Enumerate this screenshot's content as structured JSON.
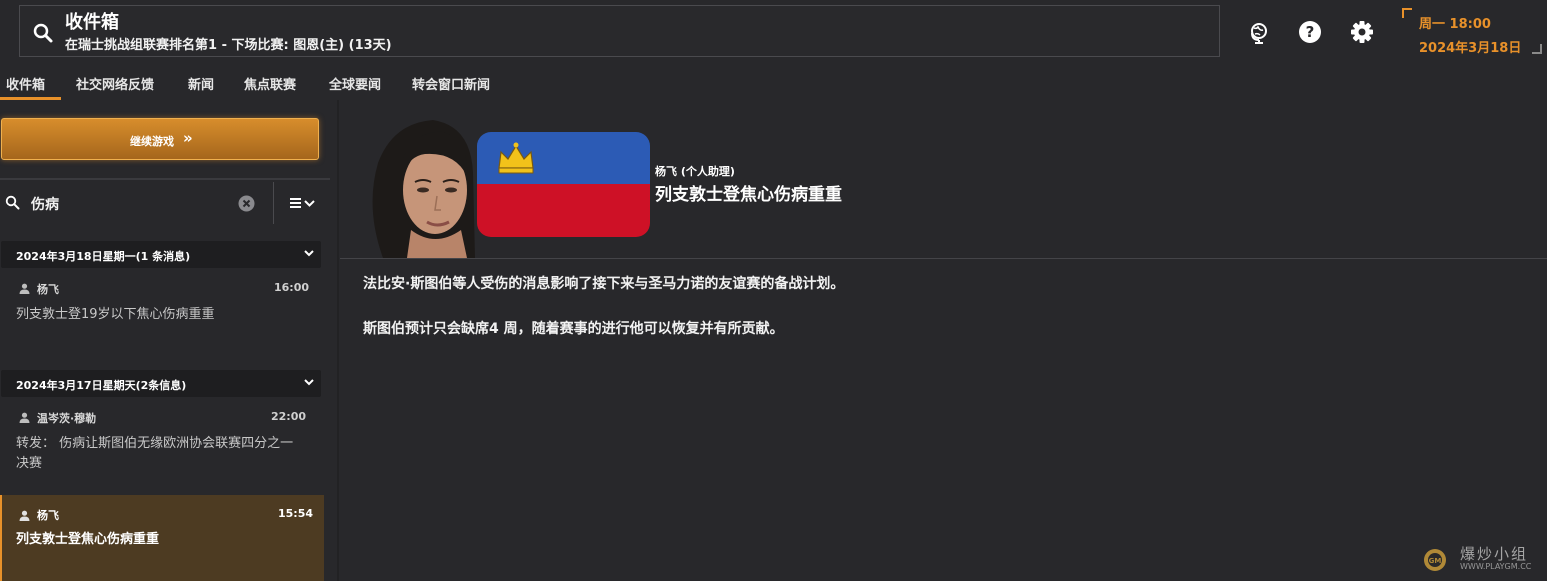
{
  "header": {
    "title": "收件箱",
    "subtitle": "在瑞士挑战组联赛排名第1 - 下场比赛: 图恩(主) (13天)",
    "icons": [
      "search-icon",
      "globe-icon",
      "help-icon",
      "gear-icon"
    ],
    "clock": {
      "time": "周一 18:00",
      "date": "2024年3月18日"
    },
    "accent_color": "#e8912a"
  },
  "tabs": [
    {
      "label": "收件箱",
      "active": true
    },
    {
      "label": "社交网络反馈"
    },
    {
      "label": "新闻"
    },
    {
      "label": "焦点联赛"
    },
    {
      "label": "全球要闻"
    },
    {
      "label": "转会窗口新闻"
    }
  ],
  "sidebar": {
    "continue_label": "继续游戏",
    "continue_chevron": "»",
    "filter_value": "伤病",
    "groups": [
      {
        "title": "2024年3月18日星期一(1 条消息)",
        "messages": [
          {
            "sender": "杨飞",
            "time": "16:00",
            "subject": "列支敦士登19岁以下焦心伤病重重"
          }
        ]
      },
      {
        "title": "2024年3月17日星期天(2条信息)",
        "messages": [
          {
            "sender": "温岑茨·穆勒",
            "time": "22:00",
            "subject": "转发： 伤病让斯图伯无缘欧洲协会联赛四分之一决赛"
          },
          {
            "sender": "杨飞",
            "time": "15:54",
            "subject": "列支敦士登焦心伤病重重",
            "selected": true
          }
        ]
      }
    ]
  },
  "message": {
    "sender_role": "杨飞 (个人助理)",
    "title": "列支敦士登焦心伤病重重",
    "flag_colors": [
      "#2c5bb5",
      "#ce1126"
    ],
    "paragraphs": [
      "法比安·斯图伯等人受伤的消息影响了接下来与圣马力诺的友谊赛的备战计划。",
      "斯图伯预计只会缺席4 周，随着赛事的进行他可以恢复并有所贡献。"
    ]
  },
  "watermark": {
    "text": "爆炒小组",
    "url": "WWW.PLAYGM.CC"
  }
}
